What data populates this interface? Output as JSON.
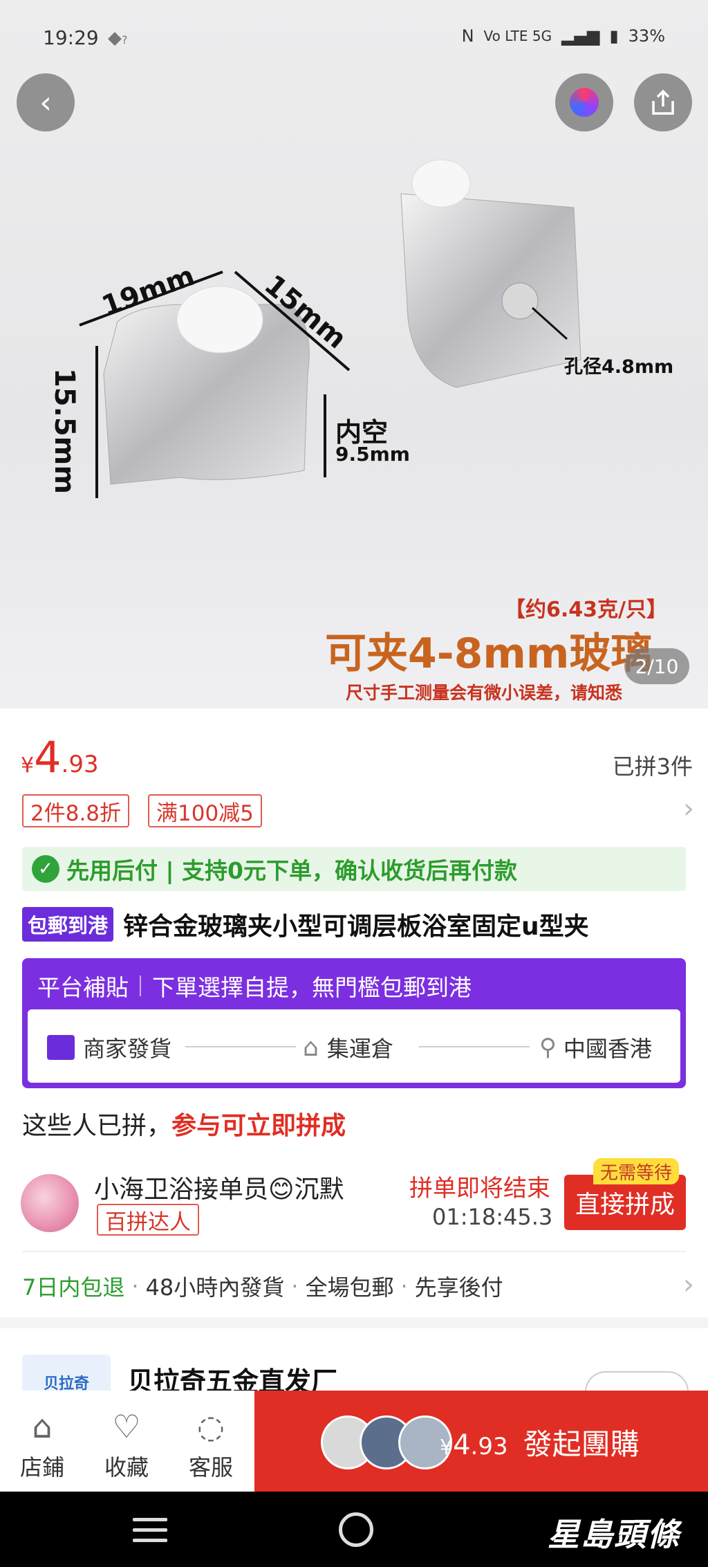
{
  "status_bar": {
    "time": "19:29",
    "wifi": "?",
    "network": "Vo LTE 5G",
    "battery": "33%"
  },
  "hero": {
    "image_counter": "2/10",
    "dims": {
      "w": "19mm",
      "d": "15mm",
      "h": "15.5mm",
      "inner_label": "内空",
      "inner_val": "9.5mm",
      "hole": "孔径4.8mm"
    },
    "weight_note": "【约6.43克/只】",
    "headline": "可夹4-8mm玻璃",
    "disclaimer": "尺寸手工测量会有微小误差，请知悉"
  },
  "price": {
    "symbol": "¥",
    "integer": "4",
    "decimal": ".93",
    "joined": "已拼3件"
  },
  "promos": [
    "2件8.8折",
    "满100减5"
  ],
  "pay_later": "先用后付 | 支持0元下单，确认收货后再付款",
  "product": {
    "badge": "包郵到港",
    "title": "锌合金玻璃夹小型可调层板浴室固定u型夹"
  },
  "shipping": {
    "platform": "平台補貼",
    "note": "下單選擇自提，無門檻包郵到港",
    "from": "商家發貨",
    "via": "集運倉",
    "to": "中國香港"
  },
  "group": {
    "heading": "这些人已拼，",
    "heading_red": "参与可立即拼成",
    "user": "小海卫浴接单员😊沉默",
    "user_badge": "百拼达人",
    "ending": "拼单即将结束",
    "timer": "01:18:45.3",
    "no_wait": "无需等待",
    "join": "直接拼成"
  },
  "guarantees": [
    "7日内包退",
    "48小時內發貨",
    "全場包郵",
    "先享後付"
  ],
  "shop": {
    "logo": "贝拉奇",
    "name": "贝拉奇五金直发厂"
  },
  "bottom": {
    "store": "店鋪",
    "favorite": "收藏",
    "service": "客服",
    "buy_symbol": "¥",
    "buy_int": "4",
    "buy_dec": ".93",
    "buy_label": "發起團購"
  },
  "watermark": "星島頭條",
  "colors": {
    "accent": "#e02e24",
    "purple": "#7b2fe0",
    "green": "#2c9c2c"
  }
}
